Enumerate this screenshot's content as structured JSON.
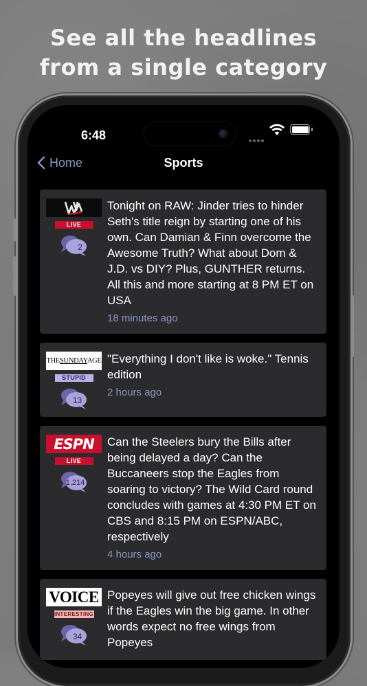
{
  "promo": {
    "line1": "See all the headlines",
    "line2": "from a single category"
  },
  "status_bar": {
    "time": "6:48"
  },
  "nav": {
    "back_label": "Home",
    "title": "Sports"
  },
  "items": [
    {
      "source": "WWE",
      "tag": "LIVE",
      "tag_bg": "#c8102e",
      "tag_fg": "#ffffff",
      "comments": "2",
      "headline": "Tonight on RAW: Jinder tries to hinder Seth's title reign by starting one of his own. Can Damian & Finn overcome the Awesome Truth? What about Dom & J.D. vs DIY? Plus, GUNTHER returns. All this and more starting at 8 PM ET on USA",
      "time": "18 minutes ago"
    },
    {
      "source": "THE SUNDAY AGE",
      "tag": "STUPID",
      "tag_bg": "#b9b3e6",
      "tag_fg": "#2b2570",
      "comments": "13",
      "headline": "\"Everything I don't like is woke.\" Tennis edition",
      "time": "2 hours ago"
    },
    {
      "source": "ESPN",
      "tag": "LIVE",
      "tag_bg": "#c8102e",
      "tag_fg": "#ffffff",
      "comments": "1,214",
      "headline": "Can the Steelers bury the Bills after being delayed a day? Can the Buccaneers stop the Eagles from soaring to victory? The Wild Card round concludes with games at 4:30 PM ET on CBS and 8:15 PM on ESPN/ABC, respectively",
      "time": "4 hours ago"
    },
    {
      "source": "VOICE",
      "tag": "INTERESTING",
      "tag_bg": "#f2b6b6",
      "tag_fg": "#7a1f1f",
      "comments": "34",
      "headline": "Popeyes will give out free chicken wings if the Eagles win the big game. In other words expect no free wings from Popeyes",
      "time": ""
    }
  ]
}
